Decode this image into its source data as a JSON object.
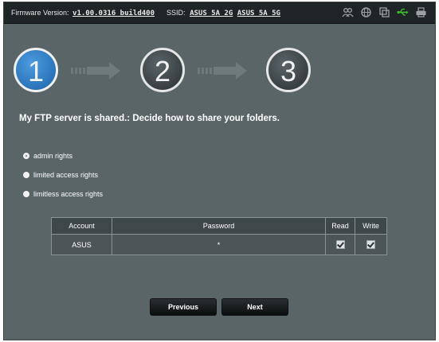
{
  "topbar": {
    "firmware_label": "Firmware Version:",
    "firmware_value": "v1.00.0316_build400",
    "ssid_label": "SSID:",
    "ssid_values": [
      "ASUS_5A_2G",
      "ASUS_5A_5G"
    ],
    "icons": [
      "users-icon",
      "globe-icon",
      "copy-icon",
      "usb-icon",
      "printer-icon"
    ]
  },
  "wizard": {
    "steps": [
      "1",
      "2",
      "3"
    ],
    "active_step": 1,
    "accent_color": "#2a79c8"
  },
  "title": "My FTP server is shared.: Decide how to share your folders.",
  "options": [
    {
      "label": "admin rights",
      "selected": true
    },
    {
      "label": "limited access rights",
      "selected": false
    },
    {
      "label": "limitless access rights",
      "selected": false
    }
  ],
  "table": {
    "headers": [
      "Account",
      "Password",
      "Read",
      "Write"
    ],
    "rows": [
      {
        "account": "ASUS",
        "password": "*",
        "read": true,
        "write": true
      }
    ]
  },
  "buttons": {
    "previous": "Previous",
    "next": "Next"
  }
}
